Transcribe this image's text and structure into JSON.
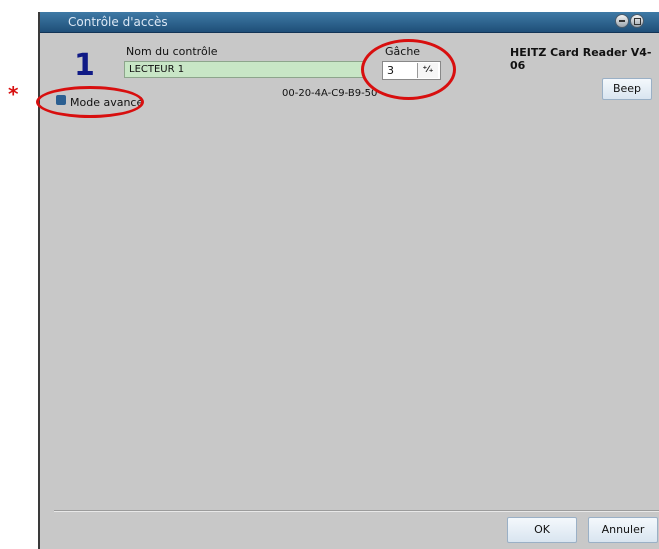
{
  "window": {
    "title": "Contrôle d'accès",
    "minimize_icon": "minimize-icon",
    "maximize_icon": "maximize-icon"
  },
  "control": {
    "number": "1",
    "name_label": "Nom du contrôle",
    "name_value": "LECTEUR 1",
    "gache_label": "Gâche",
    "gache_value": "3",
    "spinner_icon": "up-down-arrows-icon",
    "spinner_glyph": "⁺⁄₊",
    "product": "HEITZ Card Reader V4-06",
    "mac": "00-20-4A-C9-B9-50"
  },
  "buttons": {
    "beep": "Beep",
    "ok": "OK",
    "cancel": "Annuler"
  },
  "advanced": {
    "label": "Mode avancé",
    "checked": true
  },
  "annotations": {
    "asterisk": "*",
    "color": "#d80f0f"
  }
}
